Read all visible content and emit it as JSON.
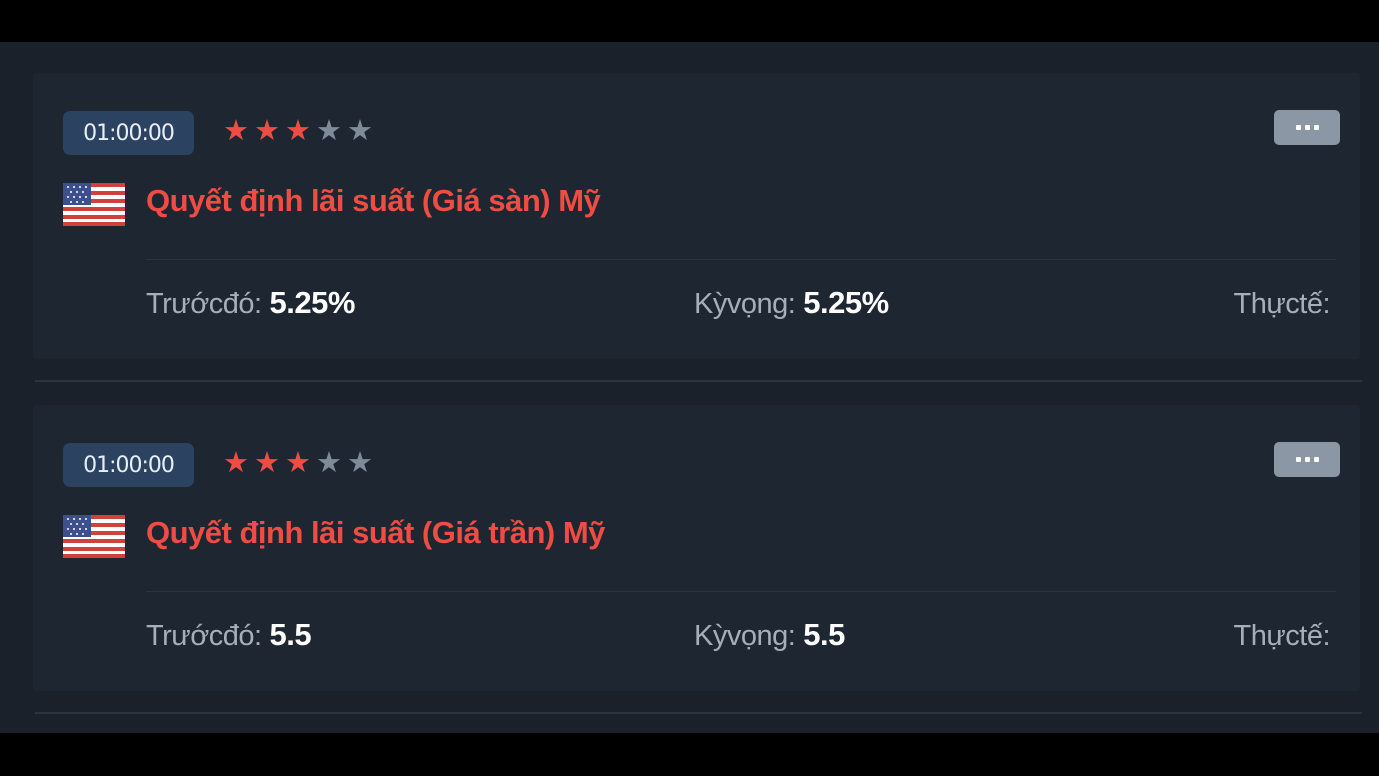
{
  "events": [
    {
      "time": "01:00:00",
      "importance": 3,
      "importance_max": 5,
      "title": "Quyết định lãi suất (Giá sàn) Mỹ",
      "country_flag": "us-flag-icon",
      "previous_label": "Trướcđó:",
      "previous_value": "5.25%",
      "forecast_label": "Kỳvọng:",
      "forecast_value": "5.25%",
      "actual_label": "Thựctế:",
      "actual_value": ""
    },
    {
      "time": "01:00:00",
      "importance": 3,
      "importance_max": 5,
      "title": "Quyết định lãi suất (Giá trần) Mỹ",
      "country_flag": "us-flag-icon",
      "previous_label": "Trướcđó:",
      "previous_value": "5.5",
      "forecast_label": "Kỳvọng:",
      "forecast_value": "5.5",
      "actual_label": "Thựctế:",
      "actual_value": ""
    }
  ],
  "colors": {
    "accent_red": "#ef4c43",
    "star_inactive": "#7e8b99",
    "badge_bg": "#2b4360",
    "card_bg": "#1e2631",
    "more_button_bg": "#8b97a4"
  }
}
